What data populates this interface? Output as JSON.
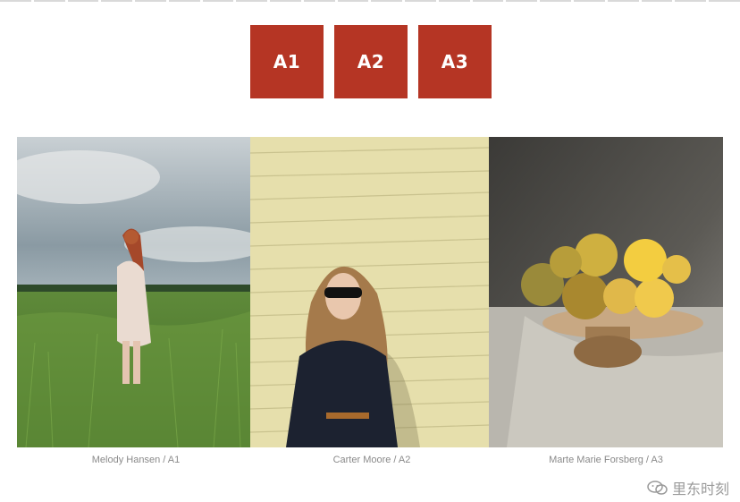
{
  "tabs": [
    {
      "label": "A1"
    },
    {
      "label": "A2"
    },
    {
      "label": "A3"
    }
  ],
  "gallery": {
    "items": [
      {
        "caption": "Melody Hansen / A1",
        "subject": "woman in dress standing in tall grass field"
      },
      {
        "caption": "Carter Moore / A2",
        "subject": "woman with sunglasses against yellow wooden wall"
      },
      {
        "caption": "Marte Marie Forsberg / A3",
        "subject": "bowl of lemons and pears in sunlight"
      }
    ]
  },
  "watermark": {
    "text": "里东时刻",
    "icon": "wechat-icon"
  },
  "colors": {
    "accent": "#b53524",
    "caption": "#8a8a8a"
  }
}
